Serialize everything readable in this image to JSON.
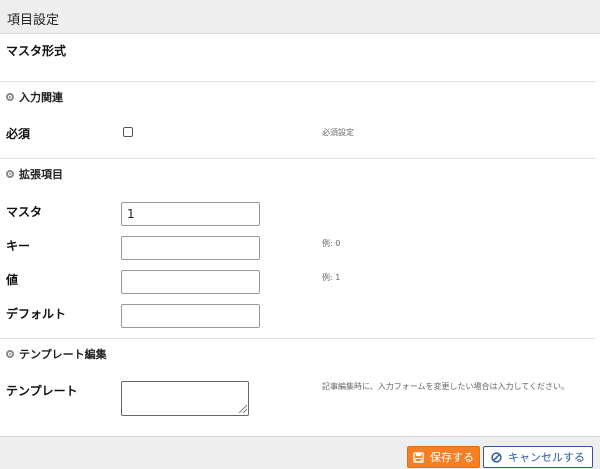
{
  "header": {
    "title": "項目設定"
  },
  "field_type": "マスタ形式",
  "sections": {
    "input": {
      "title": "入力関連"
    },
    "extension": {
      "title": "拡張項目"
    },
    "template": {
      "title": "テンプレート編集"
    }
  },
  "fields": {
    "required": {
      "label": "必須",
      "checked": false,
      "note": "必須設定"
    },
    "master": {
      "label": "マスタ",
      "value": "1"
    },
    "key": {
      "label": "キー",
      "value": "",
      "note": "例: 0"
    },
    "value": {
      "label": "値",
      "value": "",
      "note": "例: 1"
    },
    "default": {
      "label": "デフォルト",
      "value": ""
    },
    "template": {
      "label": "テンプレート",
      "value": "",
      "note": "記事編集時に、入力フォームを変更したい場合は入力してください。"
    }
  },
  "footer": {
    "save_label": "保存する",
    "cancel_label": "キャンセルする"
  },
  "colors": {
    "save_button": "#f47f24",
    "cancel_button_border": "#2a5a9c",
    "header_bg": "#eeeeee"
  }
}
